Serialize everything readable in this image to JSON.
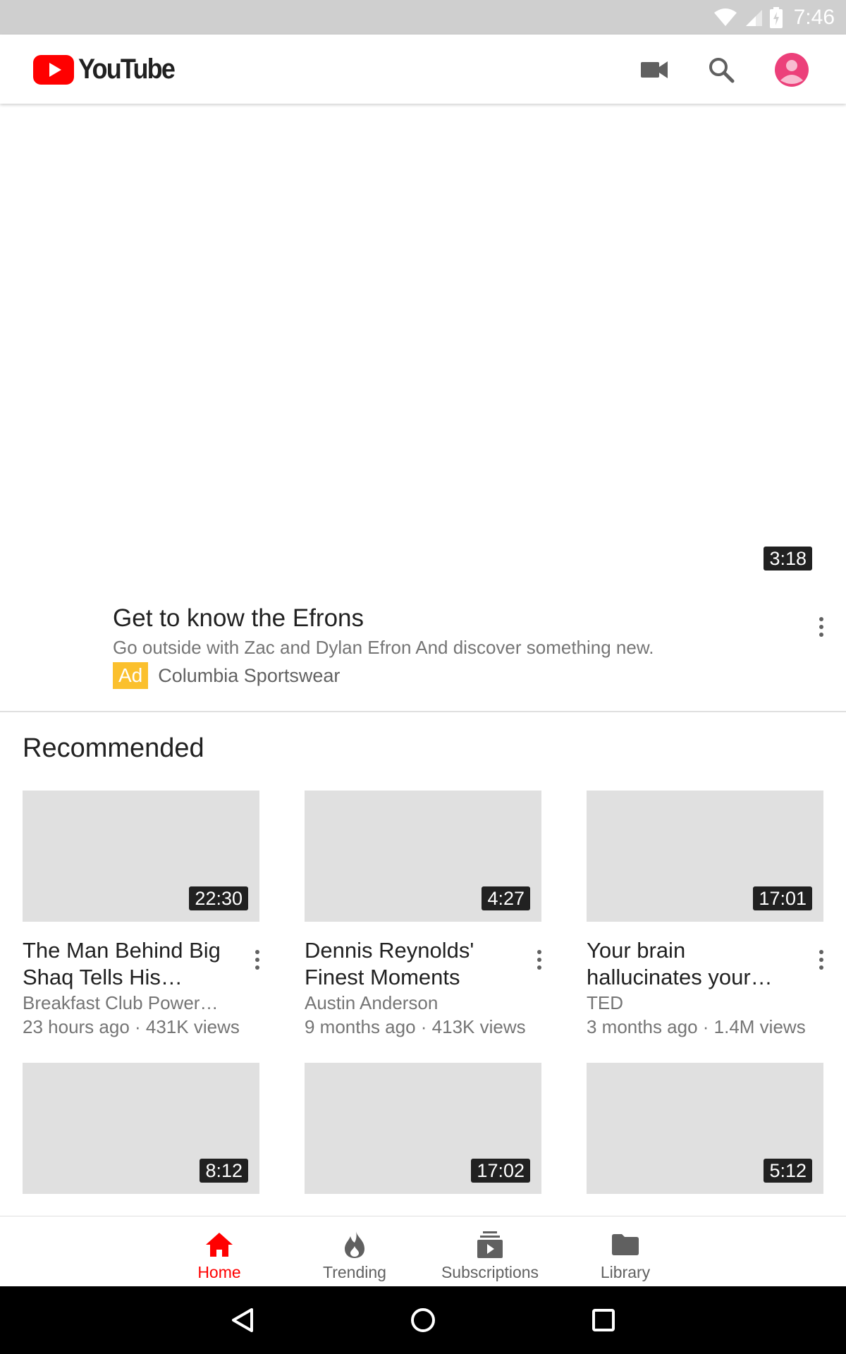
{
  "status_bar": {
    "time": "7:46"
  },
  "app": {
    "name": "YouTube",
    "brand_color": "#ff0000"
  },
  "app_bar_icons": [
    "camera-icon",
    "search-icon",
    "account-icon"
  ],
  "ad": {
    "duration": "3:18",
    "title": "Get to know the Efrons",
    "description": "Go outside with Zac and Dylan Efron And discover something new.",
    "badge": "Ad",
    "advertiser": "Columbia Sportswear",
    "badge_color": "#fbc02d"
  },
  "recommended": {
    "title": "Recommended",
    "videos": [
      {
        "duration": "22:30",
        "title": "The Man Behind Big Shaq Tells His…",
        "channel": "Breakfast Club Power…",
        "meta": "23 hours ago · 431K views"
      },
      {
        "duration": "4:27",
        "title": "Dennis Reynolds' Finest Moments",
        "channel": "Austin Anderson",
        "meta": "9 months ago · 413K views"
      },
      {
        "duration": "17:01",
        "title": "Your brain hallucinates your…",
        "channel": "TED",
        "meta": "3 months ago · 1.4M views"
      },
      {
        "duration": "8:12"
      },
      {
        "duration": "17:02"
      },
      {
        "duration": "5:12"
      }
    ]
  },
  "bottom_nav": {
    "items": [
      {
        "label": "Home",
        "icon": "home-icon",
        "active": true
      },
      {
        "label": "Trending",
        "icon": "flame-icon",
        "active": false
      },
      {
        "label": "Subscriptions",
        "icon": "subscriptions-icon",
        "active": false
      },
      {
        "label": "Library",
        "icon": "folder-icon",
        "active": false
      }
    ],
    "active_color": "#ff0000"
  },
  "system_nav": [
    "back-icon",
    "home-circle-icon",
    "recents-icon"
  ]
}
